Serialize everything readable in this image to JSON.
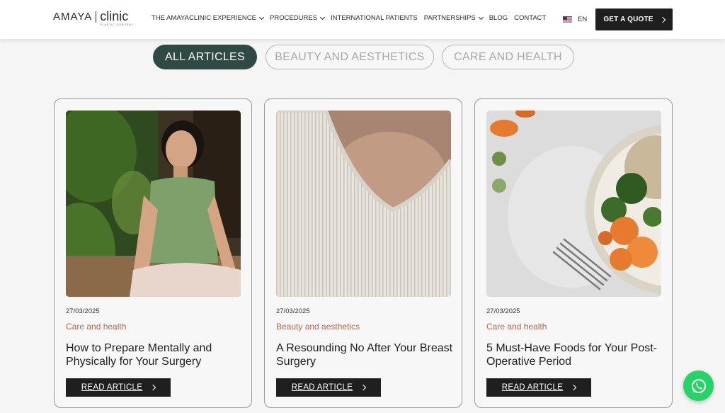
{
  "header": {
    "logo": {
      "brand": "AMAYA",
      "name": "clinic",
      "sub": "PLASTIC SURGERY"
    },
    "nav": [
      {
        "label": "THE AMAYACLINIC EXPERIENCE",
        "has_dropdown": true
      },
      {
        "label": "PROCEDURES",
        "has_dropdown": true
      },
      {
        "label": "INTERNATIONAL PATIENTS",
        "has_dropdown": false
      },
      {
        "label": "PARTNERSHIPS",
        "has_dropdown": true
      },
      {
        "label": "BLOG",
        "has_dropdown": false
      },
      {
        "label": "CONTACT",
        "has_dropdown": false
      }
    ],
    "language": {
      "label": "EN",
      "flag_icon": "us-flag-icon"
    },
    "cta_label": "GET A QUOTE"
  },
  "filters": [
    {
      "label": "ALL ARTICLES",
      "active": true
    },
    {
      "label": "BEAUTY AND AESTHETICS",
      "active": false
    },
    {
      "label": "CARE AND HEALTH",
      "active": false
    }
  ],
  "articles": [
    {
      "date": "27/03/2025",
      "category": "Care and health",
      "title": "How to Prepare Mentally and Physically for Your Surgery",
      "button_label": "READ ARTICLE",
      "image": "woman-meditating"
    },
    {
      "date": "27/03/2025",
      "category": "Beauty and aesthetics",
      "title": "A Resounding No After Your Breast Surgery",
      "button_label": "READ ARTICLE",
      "image": "ribbed-top-closeup"
    },
    {
      "date": "27/03/2025",
      "category": "Care and health",
      "title": "5 Must-Have Foods for Your Post-Operative Period",
      "button_label": "READ ARTICLE",
      "image": "vegetable-bowl"
    }
  ],
  "colors": {
    "accent": "#2f4a45",
    "category": "#b5674f",
    "dark_button": "#1f1f1f",
    "whatsapp": "#25d366"
  },
  "floating": {
    "icon": "whatsapp-icon"
  }
}
